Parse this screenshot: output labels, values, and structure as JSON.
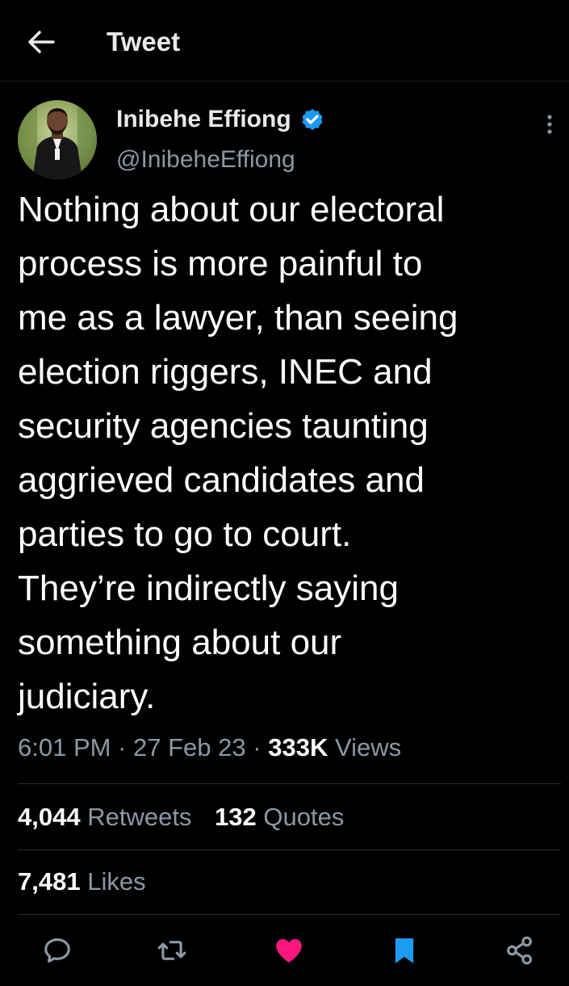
{
  "header": {
    "title": "Tweet"
  },
  "author": {
    "name": "Inibehe Effiong",
    "handle": "@InibeheEffiong",
    "verified": true
  },
  "tweet": {
    "text": "Nothing about our electoral\nprocess is more painful to\nme as a lawyer, than seeing\nelection riggers, INEC and\nsecurity agencies taunting\naggrieved candidates and\nparties to go to court.\nThey’re indirectly saying\nsomething about our\njudiciary.",
    "time": "6:01 PM",
    "separator": "·",
    "date": "27 Feb 23",
    "views_count": "333K",
    "views_label": "Views"
  },
  "stats": {
    "retweets_count": "4,044",
    "retweets_label": "Retweets",
    "quotes_count": "132",
    "quotes_label": "Quotes",
    "likes_count": "7,481",
    "likes_label": "Likes"
  },
  "actions": [
    {
      "name": "reply",
      "icon": "reply-icon"
    },
    {
      "name": "retweet",
      "icon": "retweet-icon"
    },
    {
      "name": "like",
      "icon": "heart-icon",
      "active": true
    },
    {
      "name": "bookmark",
      "icon": "bookmark-icon",
      "active": true
    },
    {
      "name": "share",
      "icon": "share-icon"
    }
  ],
  "colors": {
    "background": "#000000",
    "text_primary": "#ffffff",
    "text_secondary": "#8b98a5",
    "verified_blue": "#1d9bf0",
    "like_pink": "#f91880",
    "bookmark_blue": "#1d9bf0"
  }
}
